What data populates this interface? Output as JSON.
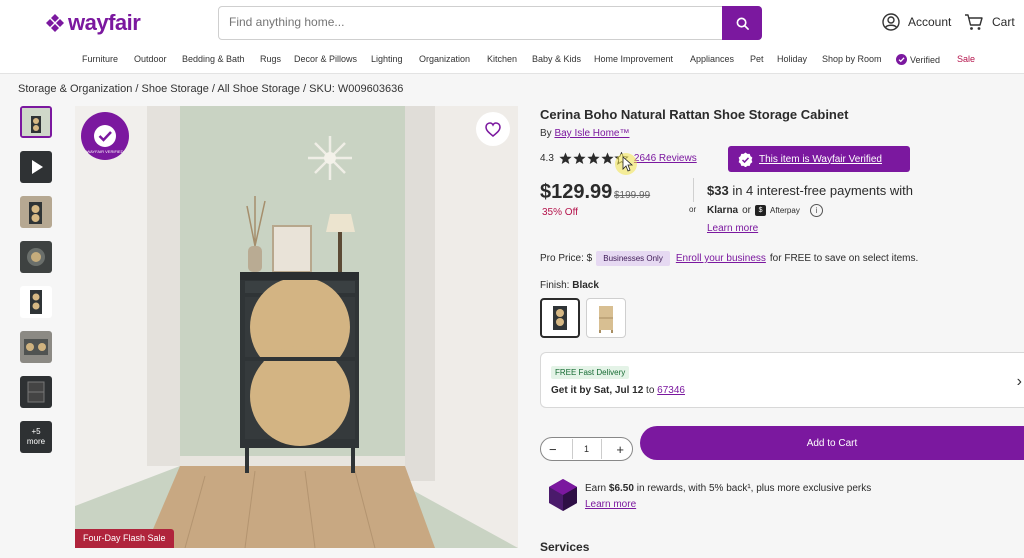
{
  "header": {
    "logo": "wayfair",
    "search_placeholder": "Find anything home...",
    "account_label": "Account",
    "cart_label": "Cart"
  },
  "nav": {
    "items": [
      "Furniture",
      "Outdoor",
      "Bedding & Bath",
      "Rugs",
      "Decor & Pillows",
      "Lighting",
      "Organization",
      "Kitchen",
      "Baby & Kids",
      "Home Improvement",
      "Appliances",
      "Pet",
      "Holiday",
      "Shop by Room",
      "Verified",
      "Sale"
    ]
  },
  "breadcrumb": {
    "items": [
      "Storage & Organization",
      "Shoe Storage",
      "All Shoe Storage",
      "SKU: W009603636"
    ],
    "separator": "/"
  },
  "gallery": {
    "more_label": "+5 more",
    "verified_seal": "WAYFAIR VERIFIED",
    "flash_sale": "Four-Day Flash Sale"
  },
  "product": {
    "title": "Cerina Boho Natural Rattan Shoe Storage Cabinet",
    "by_prefix": "By",
    "brand": "Bay Isle Home™",
    "rating": "4.3",
    "stars": 4.3,
    "reviews": "2646 Reviews",
    "verified_label": "This item is Wayfair Verified",
    "price": "$129.99",
    "was_price": "$199.99",
    "discount": "35% Off",
    "or": "or",
    "installment_amount": "$33",
    "installment_text": "in 4 interest-free payments with",
    "klarna": "Klarna",
    "klarna_or": "or",
    "afterpay": "Afterpay",
    "learn_more": "Learn more",
    "pro_price_label": "Pro Price: $",
    "businesses_only": "Businesses Only",
    "enroll_link": "Enroll your business",
    "enroll_text": "for FREE to save on select items.",
    "finish_label": "Finish:",
    "finish_value": "Black"
  },
  "delivery": {
    "tag": "FREE Fast Delivery",
    "get_it": "Get it by Sat, Jul 12",
    "to": "to",
    "zip": "67346"
  },
  "cart": {
    "qty": "1",
    "minus": "−",
    "plus": "+",
    "add_label": "Add to Cart"
  },
  "rewards": {
    "prefix": "Earn",
    "amount": "$6.50",
    "text": "in rewards, with 5% back¹, plus more exclusive perks",
    "learn_more": "Learn more"
  },
  "services_heading": "Services",
  "colors": {
    "brand": "#7b189f",
    "sale": "#b5144c",
    "flash": "#b0243c"
  }
}
